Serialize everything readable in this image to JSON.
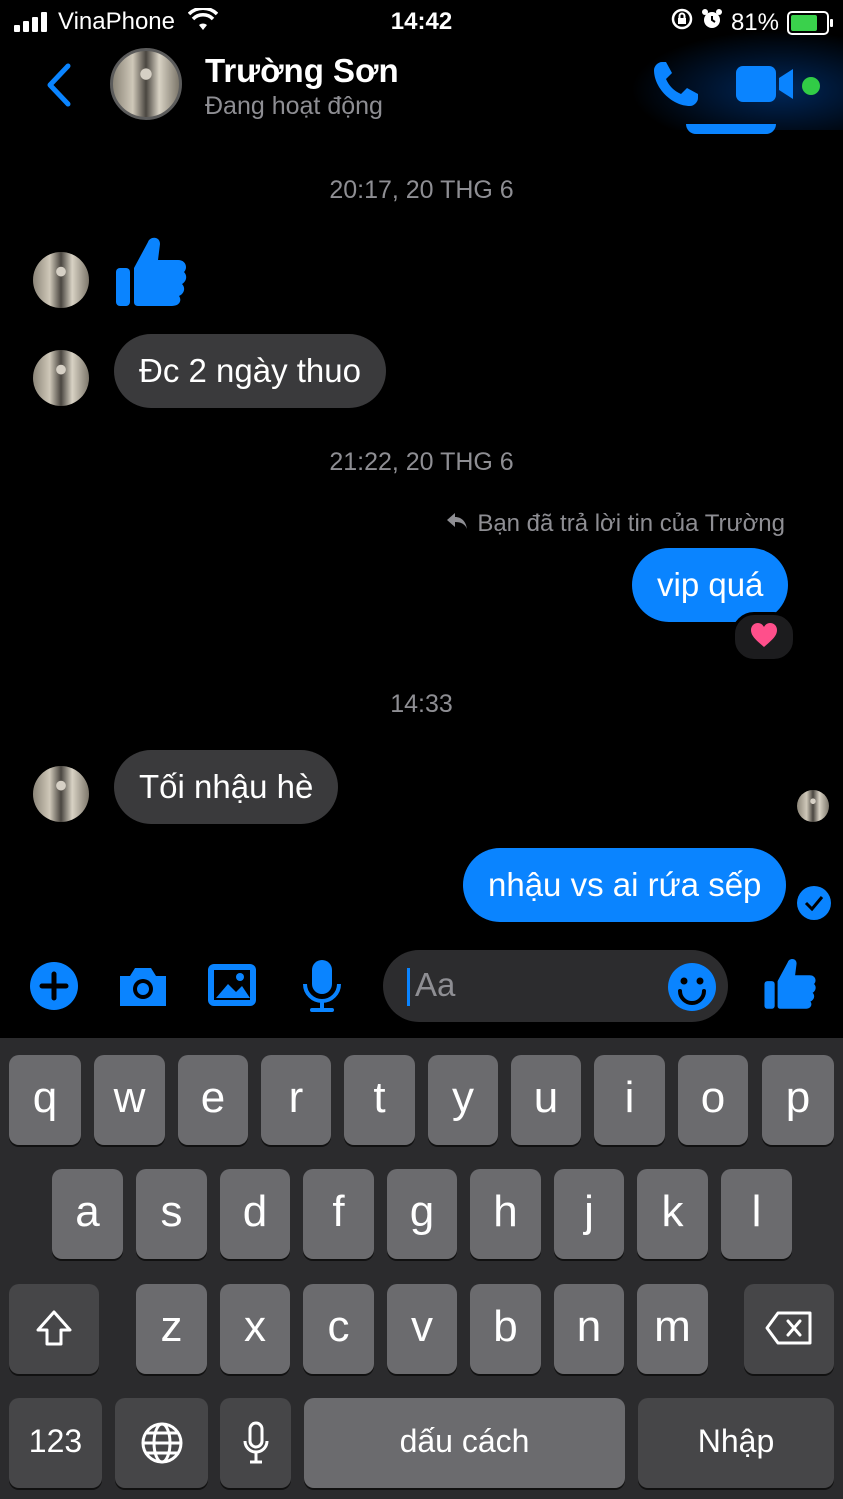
{
  "status_bar": {
    "carrier": "VinaPhone",
    "time": "14:42",
    "battery": "81%",
    "battery_level": 0.81
  },
  "header": {
    "name": "Trường Sơn",
    "status": "Đang hoạt động"
  },
  "messages": {
    "stamp1": "20:17, 20 THG 6",
    "msg_dc": "Đc 2 ngày thuo",
    "stamp2": "21:22, 20 THG 6",
    "reply_note": "Bạn đã trả lời tin của Trường",
    "msg_vip": "vip quá",
    "stamp3": "14:33",
    "msg_toi": "Tối nhậu hè",
    "msg_nhau": "nhậu vs ai rứa sếp"
  },
  "composer": {
    "placeholder": "Aa"
  },
  "keyboard": {
    "row1": [
      "q",
      "w",
      "e",
      "r",
      "t",
      "y",
      "u",
      "i",
      "o",
      "p"
    ],
    "row2": [
      "a",
      "s",
      "d",
      "f",
      "g",
      "h",
      "j",
      "k",
      "l"
    ],
    "row3": [
      "z",
      "x",
      "c",
      "v",
      "b",
      "n",
      "m"
    ],
    "numbers": "123",
    "space": "dấu cách",
    "return": "Nhập"
  },
  "colors": {
    "accent": "#0a84ff",
    "incoming_bubble": "#3a3a3c",
    "online": "#31cc46",
    "reaction_heart": "#ff4f8b"
  }
}
